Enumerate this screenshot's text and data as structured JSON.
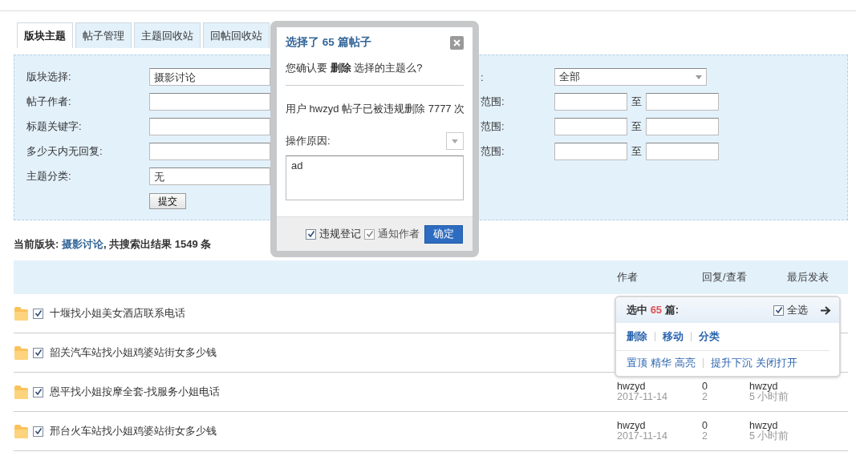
{
  "tabs": [
    {
      "label": "版块主题",
      "selected": true
    },
    {
      "label": "帖子管理",
      "selected": false
    },
    {
      "label": "主题回收站",
      "selected": false
    },
    {
      "label": "回帖回收站",
      "selected": false
    }
  ],
  "filters": {
    "left": [
      {
        "label": "版块选择:",
        "value": "摄影讨论"
      },
      {
        "label": "帖子作者:"
      },
      {
        "label": "标题关键字:"
      },
      {
        "label": "多少天内无回复:"
      },
      {
        "label": "主题分类:",
        "value": "无"
      }
    ],
    "submit": "提交",
    "right": [
      {
        "label": ":",
        "kind": "select",
        "value": "全部"
      },
      {
        "label": "范围:",
        "kind": "range",
        "to": "至"
      },
      {
        "label": "范围:",
        "kind": "range",
        "to": "至"
      },
      {
        "label": "范围:",
        "kind": "range",
        "to": "至"
      }
    ]
  },
  "summary": {
    "prefix": "当前版块: ",
    "forum": "摄影讨论",
    "suffix": ", 共搜索出结果 1549 条"
  },
  "table": {
    "columns": [
      "作者",
      "回复/查看",
      "最后发表"
    ],
    "rows": [
      {
        "title": "十堰找小姐美女酒店联系电话",
        "checked": true
      },
      {
        "title": "韶关汽车站找小姐鸡婆站街女多少钱",
        "checked": true
      },
      {
        "title": "恩平找小姐按摩全套-找服务小姐电话",
        "checked": true,
        "author": "hwzyd",
        "date": "2017-11-14",
        "replies": "0",
        "views": "2",
        "last_poster": "hwzyd",
        "last_time": "5 小时前"
      },
      {
        "title": "邢台火车站找小姐鸡婆站街女多少钱",
        "checked": true,
        "author": "hwzyd",
        "date": "2017-11-14",
        "replies": "0",
        "views": "2",
        "last_poster": "hwzyd",
        "last_time": "5 小时前"
      }
    ]
  },
  "dialog": {
    "title": "选择了 65 篇帖子",
    "question": "您确认要 **删除** 选择的主题么?",
    "notice": "用户 hwzyd 帖子已被违规删除 7777 次",
    "reason_label": "操作原因:",
    "reason": "ad",
    "options": [
      {
        "label": "违规登记",
        "checked": true,
        "disabled": false
      },
      {
        "label": "通知作者",
        "checked": true,
        "disabled": true
      }
    ],
    "confirm": "确定"
  },
  "batch_menu": {
    "prefix": "选中 ",
    "count": "65",
    "suffix": " 篇:",
    "select_all": {
      "label": "全选",
      "checked": true
    },
    "primary_actions": [
      "删除",
      "移动",
      "分类"
    ],
    "secondary_groups": [
      [
        "置顶",
        "精华",
        "高亮"
      ],
      [
        "提升下沉",
        "关闭打开"
      ]
    ]
  }
}
